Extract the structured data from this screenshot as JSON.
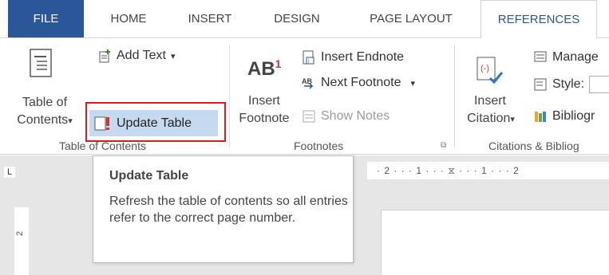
{
  "tabs": {
    "file": "FILE",
    "home": "HOME",
    "insert": "INSERT",
    "design": "DESIGN",
    "page_layout": "PAGE LAYOUT",
    "references": "REFERENCES"
  },
  "toc_group": {
    "big_button_line1": "Table of",
    "big_button_line2": "Contents",
    "dropdown_glyph": "▾",
    "add_text": "Add Text",
    "update_table": "Update Table",
    "group_label": "Table of Contents"
  },
  "footnotes_group": {
    "insert_line1": "Insert",
    "insert_line2": "Footnote",
    "ab_text": "AB",
    "superscript": "1",
    "insert_endnote": "Insert Endnote",
    "next_footnote": "Next Footnote",
    "show_notes": "Show Notes",
    "group_label": "Footnotes",
    "launcher_glyph": "⧉"
  },
  "citations_group": {
    "insert_line1": "Insert",
    "insert_line2": "Citation",
    "manage": "Manage",
    "style_label": "Style:",
    "bibliography": "Bibliogr",
    "group_label": "Citations & Bibliog"
  },
  "ruler": {
    "corner_glyph": "L",
    "horizontal_text": "· 2 · · · 1 · · · ⧖ · · · 1 · · · 2",
    "vertical_mark": "2"
  },
  "tooltip": {
    "title": "Update Table",
    "body": "Refresh the table of contents so all entries refer to the correct page number."
  },
  "colors": {
    "file_tab_bg": "#2b579a",
    "accent_text": "#2b579a",
    "hover_bg": "#c5daf0",
    "highlight_border": "#e0191f",
    "footnote_red": "#d13438"
  }
}
